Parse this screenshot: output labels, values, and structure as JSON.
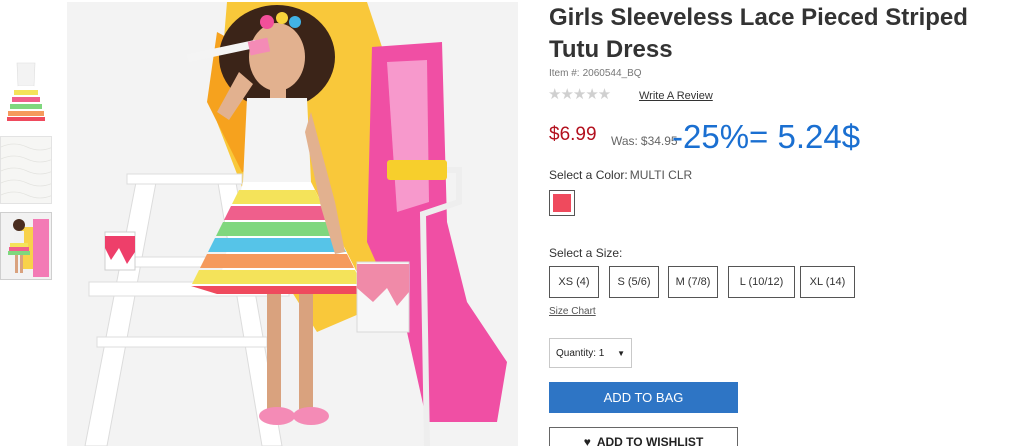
{
  "product": {
    "title": "Girls Sleeveless Lace Pieced Striped Tutu Dress",
    "item_label": "Item #:",
    "item_number": "2060544_BQ",
    "rating_stars": "★★★★★",
    "review_link": "Write A Review"
  },
  "pricing": {
    "price": "$6.99",
    "was_label": "Was:",
    "was_price": "$34.95",
    "annotation": "-25%= 5.24$"
  },
  "color": {
    "label": "Select a Color:",
    "value": "MULTI CLR",
    "swatch_hex": "#ef4a5d"
  },
  "size": {
    "label": "Select a Size:",
    "options": [
      "XS (4)",
      "S (5/6)",
      "M (7/8)",
      "L (10/12)",
      "XL (14)"
    ],
    "chart_link": "Size Chart"
  },
  "quantity": {
    "display": "Quantity: 1"
  },
  "actions": {
    "add_to_bag": "ADD TO BAG",
    "add_to_wishlist": "ADD TO WISHLIST"
  },
  "icons": {
    "heart": "heart-icon",
    "caret": "chevron-down-icon"
  }
}
